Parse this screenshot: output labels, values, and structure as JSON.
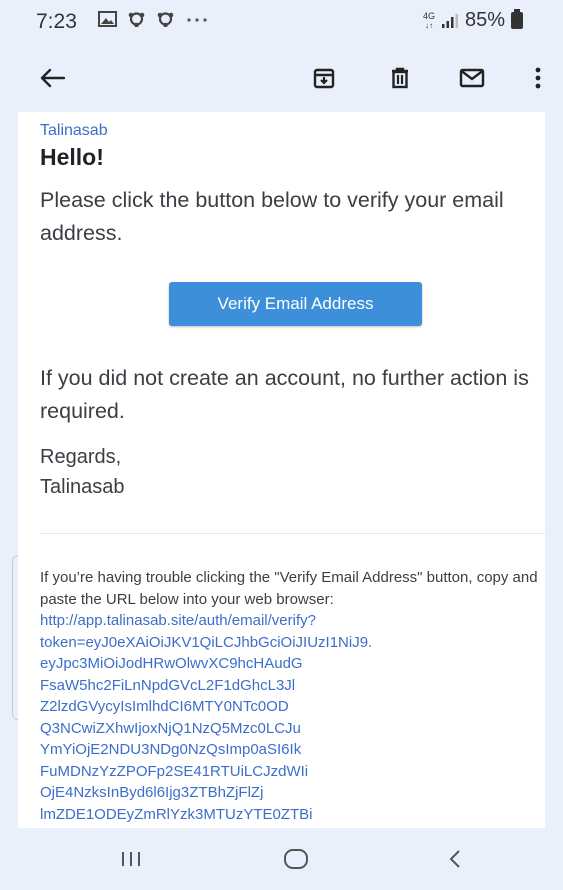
{
  "status_bar": {
    "time": "7:23",
    "network": "4G",
    "battery": "85%"
  },
  "email": {
    "sender": "Talinasab",
    "greeting": "Hello!",
    "intro": "Please click the button below to verify your email address.",
    "button_label": "Verify Email Address",
    "no_action": "If you did not create an account, no further action is required.",
    "regards": "Regards,",
    "signature": "Talinasab",
    "trouble_text": "If you’re having trouble clicking the \"Verify Email Address\" button, copy and paste the URL below into your web browser:",
    "url_lines": [
      "http://app.talinasab.site/auth/email/verify?",
      "token=eyJ0eXAiOiJKV1QiLCJhbGciOiJIUzI1NiJ9.",
      "eyJpc3MiOiJodHRwOlwvXC9hcHAudG",
      "FsaW5hc2FiLnNpdGVcL2F1dGhcL3Jl",
      "Z2lzdGVycyIsImlhdCI6MTY0NTc0OD",
      "Q3NCwiZXhwIjoxNjQ1NzQ5Mzc0LCJu",
      "YmYiOjE2NDU3NDg0NzQsImp0aSI6Ik",
      "FuMDNzYzZPOFp2SE41RTUiLCJzdWIi",
      "OjE4NzksInByd6l6Ijg3ZTBhZjFlZj",
      "lmZDE1ODEyZmRlYzk3MTUzYTE0ZTBi"
    ]
  }
}
